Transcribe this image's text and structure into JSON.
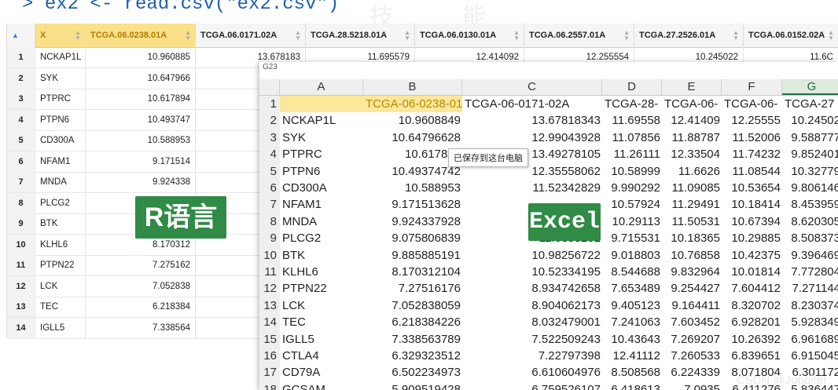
{
  "console": {
    "prompt": ">",
    "command": "ex2 <- read.csv(\"ex2.csv\")"
  },
  "r_view": {
    "headers": [
      "X",
      "TCGA.06.0238.01A",
      "TCGA.06.0171.02A",
      "TCGA.28.5218.01A",
      "TCGA.06.0130.01A",
      "TCGA.06.2557.01A",
      "TCGA.27.2526.01A",
      "TCGA.06.0152.02A"
    ],
    "rows": [
      [
        "1",
        "NCKAP1L",
        "10.960885",
        "13.678183",
        "11.695579",
        "12.414092",
        "12.255554",
        "10.245022",
        "11.6C"
      ],
      [
        "2",
        "SYK",
        "10.647966"
      ],
      [
        "3",
        "PTPRC",
        "10.617894"
      ],
      [
        "4",
        "PTPN6",
        "10.493747"
      ],
      [
        "5",
        "CD300A",
        "10.588953"
      ],
      [
        "6",
        "NFAM1",
        "9.171514"
      ],
      [
        "7",
        "MNDA",
        "9.924338"
      ],
      [
        "8",
        "PLCG2",
        ""
      ],
      [
        "9",
        "BTK",
        ""
      ],
      [
        "10",
        "KLHL6",
        "8.170312"
      ],
      [
        "11",
        "PTPN22",
        "7.275162"
      ],
      [
        "12",
        "LCK",
        "7.052838"
      ],
      [
        "13",
        "TEC",
        "6.218384"
      ],
      [
        "14",
        "IGLL5",
        "7.338564"
      ]
    ]
  },
  "excel": {
    "name_box": "G23",
    "col_headers": [
      "A",
      "B",
      "C",
      "D",
      "E",
      "F",
      "G"
    ],
    "rows": [
      [
        "1",
        "",
        "TCGA-06-0238-01A",
        "TCGA-06-0171-02A",
        "TCGA-28-",
        "TCGA-06-",
        "TCGA-06-",
        "TCGA-27"
      ],
      [
        "2",
        "NCKAP1L",
        "10.9608849",
        "13.67818343",
        "11.69558",
        "12.41409",
        "12.25555",
        "10.24502"
      ],
      [
        "3",
        "SYK",
        "10.64796628",
        "12.99043928",
        "11.07856",
        "11.88787",
        "11.52006",
        "9.588777"
      ],
      [
        "4",
        "PTPRC",
        "10.617893",
        "13.49278105",
        "11.26111",
        "12.33504",
        "11.74232",
        "9.852401"
      ],
      [
        "5",
        "PTPN6",
        "10.49374742",
        "12.35558062",
        "10.58999",
        "11.6626",
        "11.08544",
        "10.32779"
      ],
      [
        "6",
        "CD300A",
        "10.588953",
        "11.52342829",
        "9.990292",
        "11.09085",
        "10.53654",
        "9.806146"
      ],
      [
        "7",
        "NFAM1",
        "9.171513628",
        "",
        "10.57924",
        "11.29491",
        "10.18414",
        "8.453959"
      ],
      [
        "8",
        "MNDA",
        "9.924337928",
        "",
        "10.29113",
        "11.50531",
        "10.67394",
        "8.620305"
      ],
      [
        "9",
        "PLCG2",
        "9.075806839",
        "11.0358201",
        "9.715531",
        "10.18365",
        "10.29885",
        "8.508373"
      ],
      [
        "10",
        "BTK",
        "9.885885191",
        "10.98256722",
        "9.018803",
        "10.76858",
        "10.42375",
        "9.396469"
      ],
      [
        "11",
        "KLHL6",
        "8.170312104",
        "10.52334195",
        "8.544688",
        "9.832964",
        "10.01814",
        "7.772804"
      ],
      [
        "12",
        "PTPN22",
        "7.27516176",
        "8.934742658",
        "7.653489",
        "9.254427",
        "7.604412",
        "7.271144"
      ],
      [
        "13",
        "LCK",
        "7.052838059",
        "8.904062173",
        "9.405123",
        "9.164411",
        "8.320702",
        "8.230374"
      ],
      [
        "14",
        "TEC",
        "6.218384226",
        "8.032479001",
        "7.241063",
        "7.603452",
        "6.928201",
        "5.928349"
      ],
      [
        "15",
        "IGLL5",
        "7.338563789",
        "7.522509243",
        "10.43643",
        "7.269207",
        "10.26392",
        "6.961689"
      ],
      [
        "16",
        "CTLA4",
        "6.329323512",
        "7.22797398",
        "12.41112",
        "7.260533",
        "6.839651",
        "6.915045"
      ],
      [
        "17",
        "CD79A",
        "6.502234973",
        "6.610604976",
        "8.508568",
        "6.224339",
        "8.071804",
        "6.301172"
      ],
      [
        "18",
        "GCSAM",
        "5.909519428",
        "6.759526107",
        "6.418613",
        "7.0935",
        "6.411276",
        "5.836447"
      ]
    ]
  },
  "tooltip": "已保存到这台电脑",
  "badges": {
    "r": "R语言",
    "excel": "Excel"
  },
  "watermark": "CSDN @Juppiter",
  "bg_watermark": "技 能",
  "colors": {
    "highlight": "#fce79a",
    "badge_green": "#2f8b45",
    "console_blue": "#1f5fae"
  }
}
